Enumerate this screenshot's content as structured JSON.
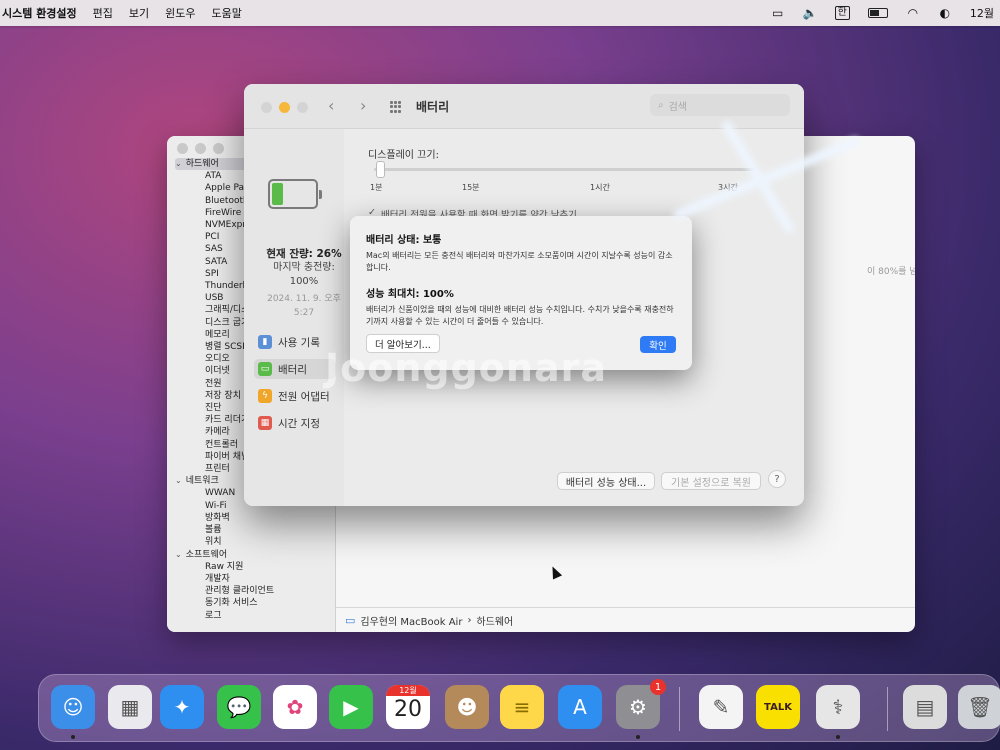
{
  "menubar": {
    "app_name": "시스템 환경설정",
    "menus": [
      "편집",
      "보기",
      "윈도우",
      "도움말"
    ],
    "input_source": "한",
    "clock": "12월"
  },
  "sysinfo": {
    "tree": [
      {
        "type": "group",
        "label": "하드웨어",
        "selected": true
      },
      {
        "type": "leaf",
        "label": "ATA"
      },
      {
        "type": "leaf",
        "label": "Apple Pay"
      },
      {
        "type": "leaf",
        "label": "Bluetooth"
      },
      {
        "type": "leaf",
        "label": "FireWire"
      },
      {
        "type": "leaf",
        "label": "NVMExpress"
      },
      {
        "type": "leaf",
        "label": "PCI"
      },
      {
        "type": "leaf",
        "label": "SAS"
      },
      {
        "type": "leaf",
        "label": "SATA"
      },
      {
        "type": "leaf",
        "label": "SPI"
      },
      {
        "type": "leaf",
        "label": "Thunderbolt"
      },
      {
        "type": "leaf",
        "label": "USB"
      },
      {
        "type": "leaf",
        "label": "그래픽/디스플레이"
      },
      {
        "type": "leaf",
        "label": "디스크 굽기"
      },
      {
        "type": "leaf",
        "label": "메모리"
      },
      {
        "type": "leaf",
        "label": "병렬 SCSI"
      },
      {
        "type": "leaf",
        "label": "오디오"
      },
      {
        "type": "leaf",
        "label": "이더넷"
      },
      {
        "type": "leaf",
        "label": "전원"
      },
      {
        "type": "leaf",
        "label": "저장 장치"
      },
      {
        "type": "leaf",
        "label": "진단"
      },
      {
        "type": "leaf",
        "label": "카드 리더기"
      },
      {
        "type": "leaf",
        "label": "카메라"
      },
      {
        "type": "leaf",
        "label": "컨트롤러"
      },
      {
        "type": "leaf",
        "label": "파이버 채널"
      },
      {
        "type": "leaf",
        "label": "프린터"
      },
      {
        "type": "group",
        "label": "네트워크",
        "selected": false
      },
      {
        "type": "leaf",
        "label": "WWAN"
      },
      {
        "type": "leaf",
        "label": "Wi-Fi"
      },
      {
        "type": "leaf",
        "label": "방화벽"
      },
      {
        "type": "leaf",
        "label": "볼륨"
      },
      {
        "type": "leaf",
        "label": "위치"
      },
      {
        "type": "group",
        "label": "소프트웨어",
        "selected": false
      },
      {
        "type": "leaf",
        "label": "Raw 지원"
      },
      {
        "type": "leaf",
        "label": "개발자"
      },
      {
        "type": "leaf",
        "label": "관리형 클라이언트"
      },
      {
        "type": "leaf",
        "label": "동기화 서비스"
      },
      {
        "type": "leaf",
        "label": "로그"
      }
    ],
    "path": [
      "김우현의 MacBook Air",
      "하드웨어"
    ],
    "path_separator": "›",
    "bg_text": "이 80%를 넘어가면"
  },
  "battery_window": {
    "title": "배터리",
    "search_placeholder": "검색",
    "status": {
      "charge_label": "현재 잔량: 26%",
      "last_charged_label": "마지막 충전량:",
      "last_charged_value": "100%",
      "date": "2024. 11. 9. 오후",
      "time": "5:27",
      "charge_level": 0.26
    },
    "sidebar": [
      {
        "label": "사용 기록",
        "icon": "bar-chart-icon",
        "color": "#5b8fd6",
        "selected": false
      },
      {
        "label": "배터리",
        "icon": "battery-icon",
        "color": "#5bbb4a",
        "selected": true
      },
      {
        "label": "전원 어댑터",
        "icon": "bolt-icon",
        "color": "#f0a62a",
        "selected": false
      },
      {
        "label": "시간 지정",
        "icon": "calendar-icon",
        "color": "#e05a4e",
        "selected": false
      }
    ],
    "display_off_label": "디스플레이 끄기:",
    "ticks": [
      "1분",
      "15분",
      "1시간",
      "3시간"
    ],
    "checkbox_label": "배터리 전원을 사용할 때 화면 밝기를 약간 낮추기",
    "battery_health_button": "배터리 성능 상태...",
    "restore_defaults_button": "기본 설정으로 복원",
    "help_button": "?"
  },
  "dialog": {
    "heading1": "배터리 상태: 보통",
    "body1": "Mac의 배터리는 모든 충전식 배터리와 마찬가지로 소모품이며 시간이 지날수록 성능이 감소합니다.",
    "heading2": "성능 최대치: 100%",
    "body2": "배터리가 신품이었을 때의 성능에 대비한 배터리 성능 수치입니다. 수치가 낮을수록 재충전하기까지 사용할 수 있는 시간이 더 줄어들 수 있습니다.",
    "learn_more_button": "더 알아보기...",
    "ok_button": "확인"
  },
  "watermark": "Joonggonara",
  "dock": [
    {
      "name": "finder-icon",
      "glyph": "☺",
      "bg": "#3b8fe8",
      "dot": true
    },
    {
      "name": "launchpad-icon",
      "glyph": "▦",
      "bg": "#e9e9ee",
      "dot": false
    },
    {
      "name": "safari-icon",
      "glyph": "✦",
      "bg": "#2e8ff0",
      "dot": false
    },
    {
      "name": "messages-icon",
      "glyph": "💬",
      "bg": "#36c24a",
      "dot": false
    },
    {
      "name": "photos-icon",
      "glyph": "✿",
      "bg": "#ffffff",
      "dot": false
    },
    {
      "name": "facetime-icon",
      "glyph": "▶",
      "bg": "#36c24a",
      "dot": false
    },
    {
      "name": "calendar-icon",
      "glyph": "",
      "bg": "#ffffff",
      "dot": false,
      "month": "12월",
      "day": "20"
    },
    {
      "name": "contacts-icon",
      "glyph": "☻",
      "bg": "#b58a5a",
      "dot": false
    },
    {
      "name": "notes-icon",
      "glyph": "≡",
      "bg": "#ffd84a",
      "dot": false
    },
    {
      "name": "app-store-icon",
      "glyph": "A",
      "bg": "#2e8ff0",
      "dot": false
    },
    {
      "name": "system-preferences-icon",
      "glyph": "⚙",
      "bg": "#8e8e93",
      "dot": true,
      "badge": "1"
    },
    {
      "name": "textedit-icon",
      "glyph": "✎",
      "bg": "#f4f4f4",
      "dot": false
    },
    {
      "name": "kakaotalk-icon",
      "glyph": "TALK",
      "bg": "#f9e000",
      "dot": false
    },
    {
      "name": "system-information-icon",
      "glyph": "⚕",
      "bg": "#e6e6e6",
      "dot": true
    },
    {
      "name": "downloads-icon",
      "glyph": "▤",
      "bg": "#dcdcdc",
      "dot": false
    },
    {
      "name": "trash-icon",
      "glyph": "🗑",
      "bg": "#cfd3d8",
      "dot": false
    }
  ]
}
